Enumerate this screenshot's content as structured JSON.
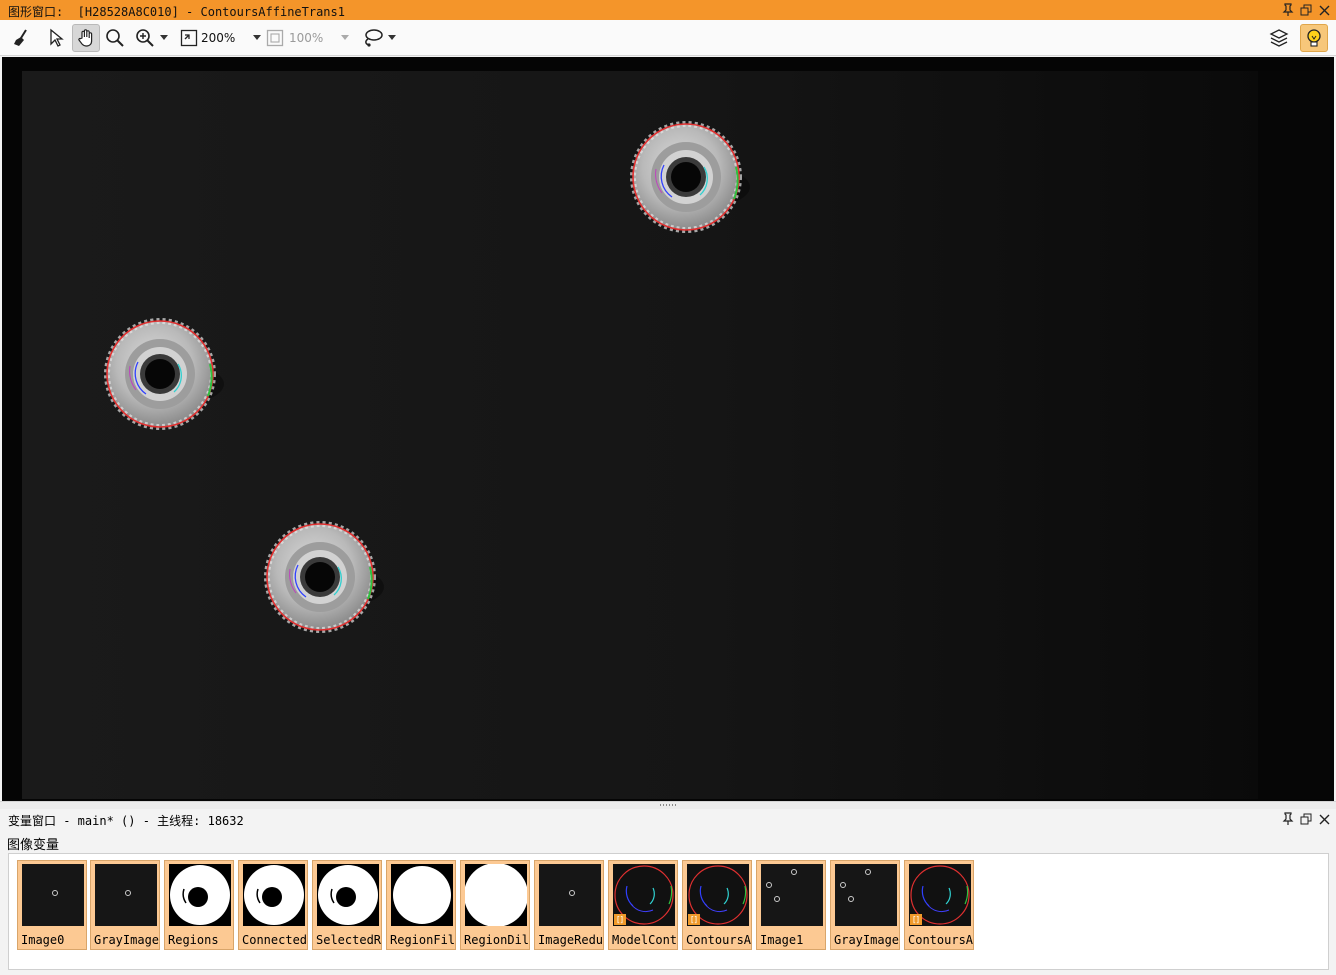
{
  "graphics_window": {
    "title": "图形窗口:  [H28528A8C010] - ContoursAffineTrans1",
    "title_bar_color": "#f4952a",
    "toolbar": {
      "clear_icon": "broom-icon",
      "select_icon": "pointer-icon",
      "pan_icon": "hand-icon",
      "magnify_icon": "magnifier-icon",
      "zoom_in_icon": "zoom-in-icon",
      "zoom_level": "200%",
      "zoom_level_alt": "100%",
      "roi_icon": "lasso-icon",
      "layers_icon": "layers-icon",
      "hint_icon": "lightbulb-icon"
    }
  },
  "variable_window": {
    "title": "变量窗口 - main* () - 主线程: 18632",
    "section_label": "图像变量",
    "thumbnails": [
      {
        "label": "Image0",
        "kind": "gray-single"
      },
      {
        "label": "GrayImage",
        "kind": "gray-single"
      },
      {
        "label": "Regions",
        "kind": "region-ring"
      },
      {
        "label": "Connected",
        "kind": "region-ring"
      },
      {
        "label": "SelectedR",
        "kind": "region-ring"
      },
      {
        "label": "RegionFil",
        "kind": "region-filled"
      },
      {
        "label": "RegionDil",
        "kind": "region-filled-large"
      },
      {
        "label": "ImageRedu",
        "kind": "gray-single"
      },
      {
        "label": "ModelCont",
        "kind": "contour"
      },
      {
        "label": "ContoursA",
        "kind": "contour"
      },
      {
        "label": "Image1",
        "kind": "gray-triple"
      },
      {
        "label": "GrayImage",
        "kind": "gray-triple"
      },
      {
        "label": "ContoursA",
        "kind": "contour"
      }
    ],
    "badge_text": "[]",
    "accent_color": "#fcc993"
  }
}
